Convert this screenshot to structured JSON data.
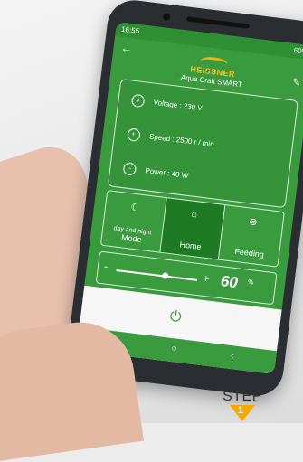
{
  "status": {
    "time": "16:55",
    "right": "60%"
  },
  "brand": {
    "name": "HEISSNER",
    "subtitle": "Aqua Craft SMART"
  },
  "info": {
    "voltage": "Voltage :  230 V",
    "speed": "Speed :  2500 r / min",
    "power": "Power :  40 W"
  },
  "modes": [
    {
      "label_top": "day and night",
      "label": "Mode",
      "icon": "moon-icon"
    },
    {
      "label": "Home",
      "icon": "home-icon"
    },
    {
      "label": "Feeding",
      "icon": "feeding-icon"
    }
  ],
  "slider": {
    "minus": "-",
    "plus": "+",
    "value": "60",
    "unit": "%",
    "level": 0.6
  },
  "nav": {
    "recents": "|||",
    "home": "○",
    "back": "‹"
  },
  "step": {
    "label": "STEP",
    "number": "1"
  },
  "colors": {
    "app_green": "#3a9a3e",
    "accent": "#f2a900"
  }
}
